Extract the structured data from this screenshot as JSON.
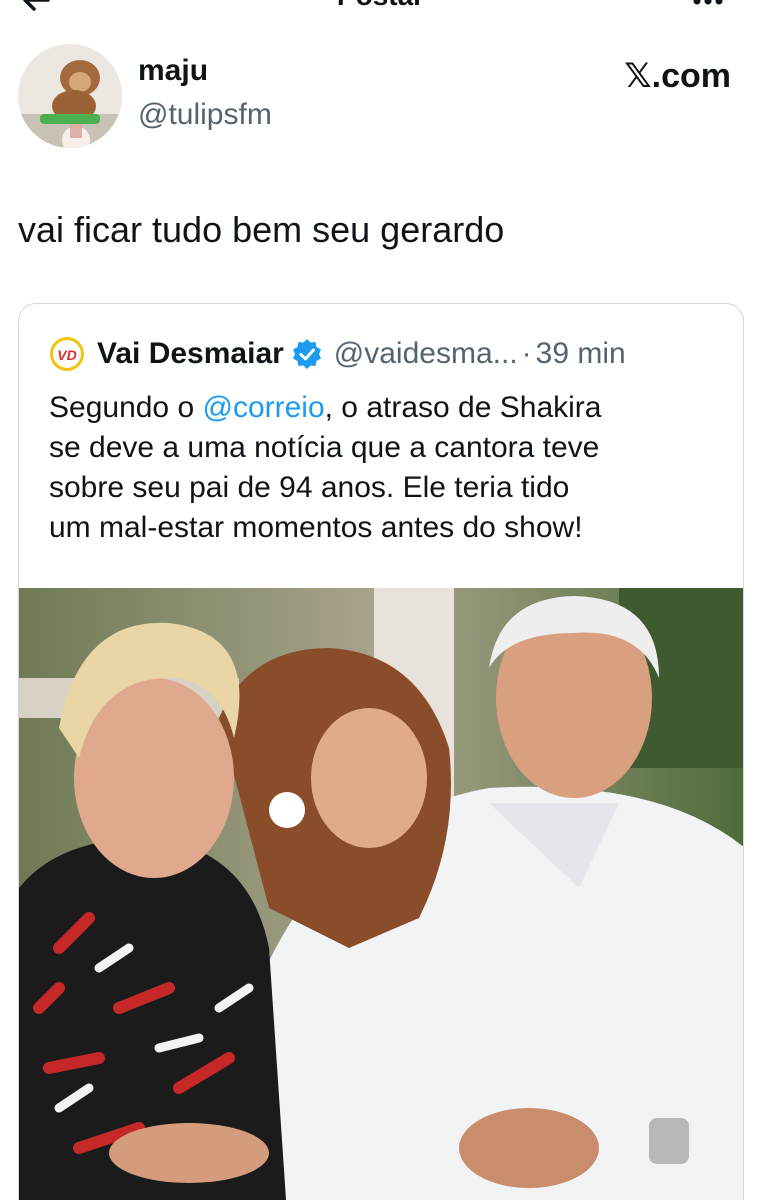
{
  "header": {
    "title": "Postar",
    "back_icon": "arrow-left-icon",
    "more_icon": "more-horizontal-icon"
  },
  "post": {
    "author_name": "maju",
    "author_handle": "@tulipsfm",
    "source": "𝕏.com",
    "text": "vai ficar tudo bem seu gerardo"
  },
  "quoted_post": {
    "author_name": "Vai Desmaiar",
    "author_handle": "@vaidesma...",
    "separator": "·",
    "time": "39 min",
    "avatar_text": "VD",
    "text_lines": [
      {
        "pre": "Segundo o ",
        "mention": "@correio",
        "post": ", o atraso de Shakira"
      },
      {
        "pre": "se deve a uma notícia que a cantora teve"
      },
      {
        "pre": "sobre seu pai de 94 anos. Ele teria tido"
      },
      {
        "pre": "um mal-estar momentos antes do show!"
      }
    ]
  },
  "colors": {
    "text": "#0f1419",
    "secondary": "#536471",
    "link": "#1d9bf0",
    "verified": "#1d9bf0",
    "border": "#cfd9de"
  }
}
